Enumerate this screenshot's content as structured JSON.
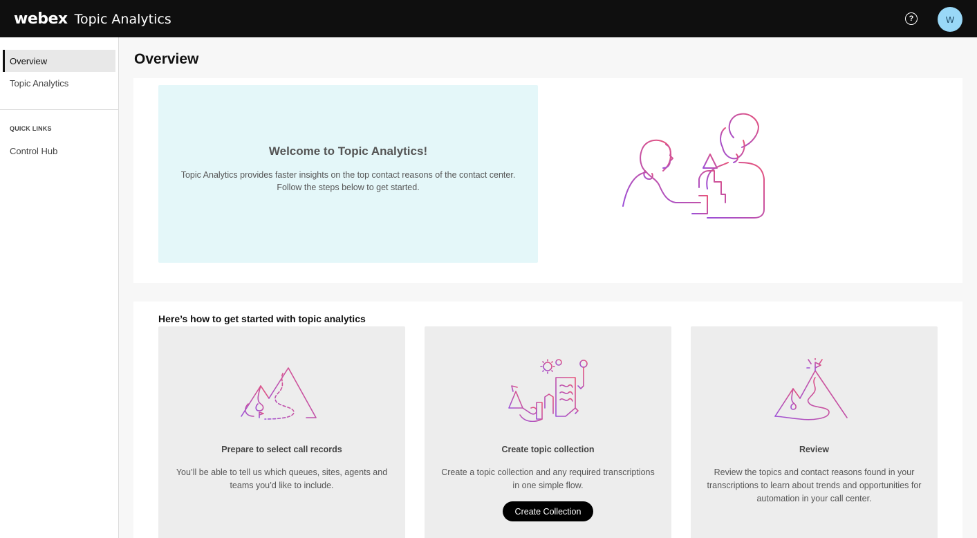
{
  "header": {
    "brand": "webex",
    "app_title": "Topic Analytics",
    "help_icon": "?",
    "avatar_initial": "W"
  },
  "sidebar": {
    "items": [
      {
        "label": "Overview",
        "active": true
      },
      {
        "label": "Topic Analytics",
        "active": false
      }
    ],
    "quick_links_title": "QUICK LINKS",
    "quick_links": [
      {
        "label": "Control Hub"
      }
    ]
  },
  "main": {
    "page_title": "Overview",
    "welcome": {
      "title": "Welcome to Topic Analytics!",
      "description": "Topic Analytics provides faster insights on the top contact reasons of the contact center. Follow the steps below to get started."
    },
    "steps_title": "Here’s how to get started with topic analytics",
    "steps": [
      {
        "title": "Prepare to select call records",
        "description": "You’ll be able to tell us which queues, sites, agents and teams you’d like to include."
      },
      {
        "title": "Create topic collection",
        "description": "Create a topic collection and any required transcriptions in one simple flow.",
        "button_label": "Create Collection"
      },
      {
        "title": "Review",
        "description": "Review the topics and contact reasons found in your transcriptions to learn about trends and opportunities for automation in your call center."
      }
    ]
  },
  "colors": {
    "accent_gradient_start": "#9b4fd8",
    "accent_gradient_end": "#e8547a",
    "welcome_bg": "#e4f7f9",
    "header_bg": "#0f0f0f",
    "avatar_bg": "#99d8f7"
  }
}
